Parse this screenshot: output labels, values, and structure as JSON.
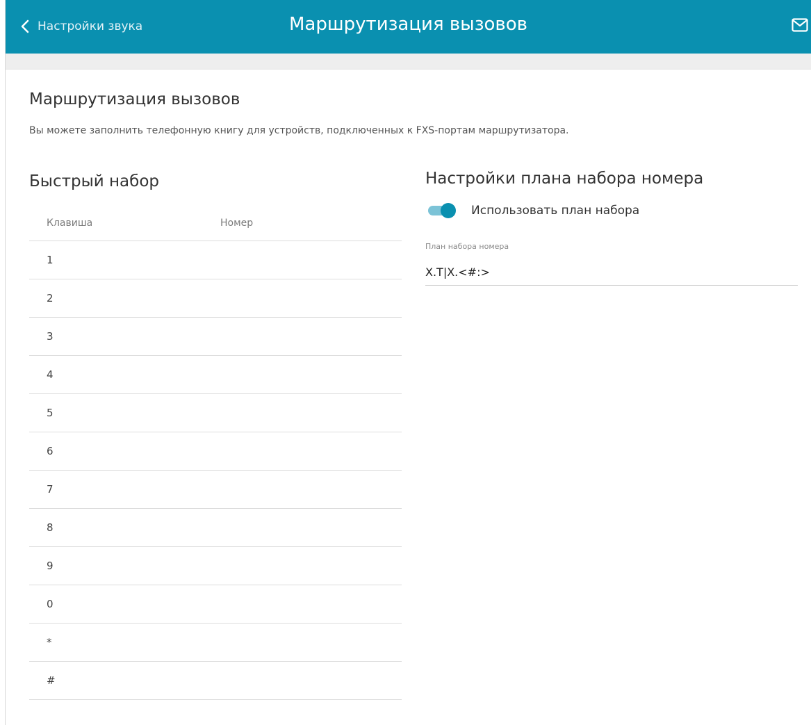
{
  "header": {
    "back_label": "Настройки звука",
    "title": "Маршрутизация вызовов",
    "accent_color": "#0a90b0"
  },
  "page": {
    "title": "Маршрутизация вызовов",
    "description": "Вы можете заполнить телефонную книгу для устройств, подключенных к FXS-портам маршрутизатора."
  },
  "speed_dial": {
    "title": "Быстрый набор",
    "columns": [
      "Клавиша",
      "Номер"
    ],
    "rows": [
      {
        "key": "1",
        "number": ""
      },
      {
        "key": "2",
        "number": ""
      },
      {
        "key": "3",
        "number": ""
      },
      {
        "key": "4",
        "number": ""
      },
      {
        "key": "5",
        "number": ""
      },
      {
        "key": "6",
        "number": ""
      },
      {
        "key": "7",
        "number": ""
      },
      {
        "key": "8",
        "number": ""
      },
      {
        "key": "9",
        "number": ""
      },
      {
        "key": "0",
        "number": ""
      },
      {
        "key": "*",
        "number": ""
      },
      {
        "key": "#",
        "number": ""
      }
    ]
  },
  "dial_plan": {
    "title": "Настройки плана набора номера",
    "toggle_label": "Использовать план набора",
    "toggle_on": true,
    "field_label": "План набора номера",
    "field_value": "X.T|X.<#:>"
  },
  "icons": {
    "back": "chevron-left-icon",
    "mail": "mail-icon"
  }
}
